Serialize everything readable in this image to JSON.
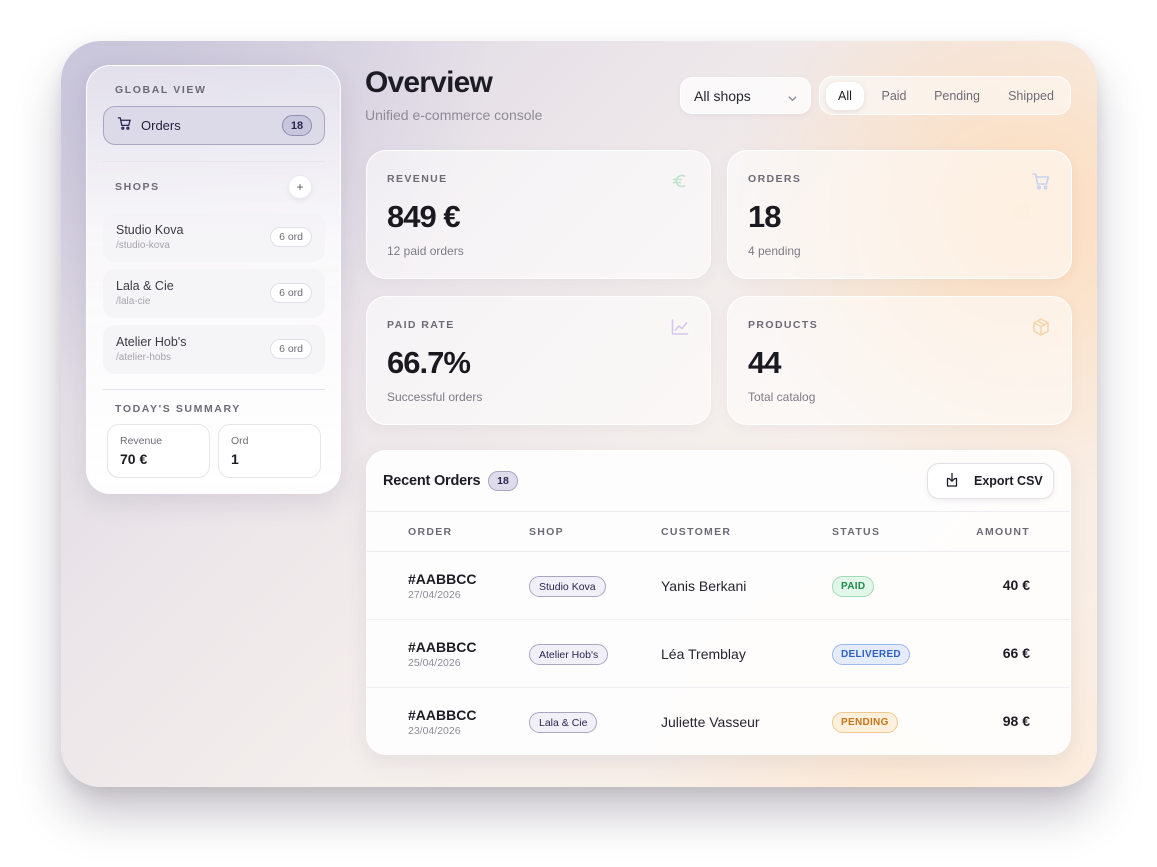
{
  "sidebar": {
    "global_label": "GLOBAL VIEW",
    "orders_nav": {
      "label": "Orders",
      "count": "18"
    },
    "shops_label": "SHOPS",
    "add_label": "+",
    "shops": [
      {
        "name": "Studio Kova",
        "slug": "/studio-kova",
        "count": "6 ord"
      },
      {
        "name": "Lala & Cie",
        "slug": "/lala-cie",
        "count": "6 ord"
      },
      {
        "name": "Atelier Hob's",
        "slug": "/atelier-hobs",
        "count": "6 ord"
      }
    ],
    "summary_label": "TODAY'S SUMMARY",
    "summary": [
      {
        "label": "Revenue",
        "value": "70 €"
      },
      {
        "label": "Ord",
        "value": "1"
      }
    ]
  },
  "header": {
    "title": "Overview",
    "subtitle": "Unified e-commerce console",
    "shop_select": "All shops",
    "filters": [
      "All",
      "Paid",
      "Pending",
      "Shipped"
    ],
    "active_filter": "All"
  },
  "stats": [
    {
      "label": "REVENUE",
      "value": "849 €",
      "note": "12 paid orders",
      "icon": "euro-icon",
      "icon_color": "#bfe3cf"
    },
    {
      "label": "ORDERS",
      "value": "18",
      "note": "4 pending",
      "icon": "cart-icon",
      "icon_color": "#c7d3ef"
    },
    {
      "label": "PAID RATE",
      "value": "66.7%",
      "note": "Successful orders",
      "icon": "trend-chart-icon",
      "icon_color": "#d5c8ef"
    },
    {
      "label": "PRODUCTS",
      "value": "44",
      "note": "Total catalog",
      "icon": "package-icon",
      "icon_color": "#f7d6ae"
    }
  ],
  "orders": {
    "title": "Recent Orders",
    "count": "18",
    "export_label": "Export CSV",
    "columns": [
      "ORDER",
      "SHOP",
      "CUSTOMER",
      "STATUS",
      "AMOUNT"
    ],
    "rows": [
      {
        "id": "#AABBCC",
        "date": "27/04/2026",
        "shop": "Studio Kova",
        "customer": "Yanis Berkani",
        "status": "PAID",
        "amount": "40 €"
      },
      {
        "id": "#AABBCC",
        "date": "25/04/2026",
        "shop": "Atelier Hob's",
        "customer": "Léa Tremblay",
        "status": "DELIVERED",
        "amount": "66 €"
      },
      {
        "id": "#AABBCC",
        "date": "23/04/2026",
        "shop": "Lala & Cie",
        "customer": "Juliette Vasseur",
        "status": "PENDING",
        "amount": "98 €"
      }
    ]
  },
  "colors": {
    "accent": "#2a2550",
    "status_paid_bg": "#e3f6ea",
    "status_paid_border": "#9fdcb5",
    "status_paid_text": "#1e8a4c",
    "status_delivered_bg": "#e4ecfb",
    "status_delivered_border": "#9fb9ec",
    "status_delivered_text": "#2f5fc4",
    "status_pending_bg": "#fdf0dc",
    "status_pending_border": "#f1c98c",
    "status_pending_text": "#c7751a"
  }
}
